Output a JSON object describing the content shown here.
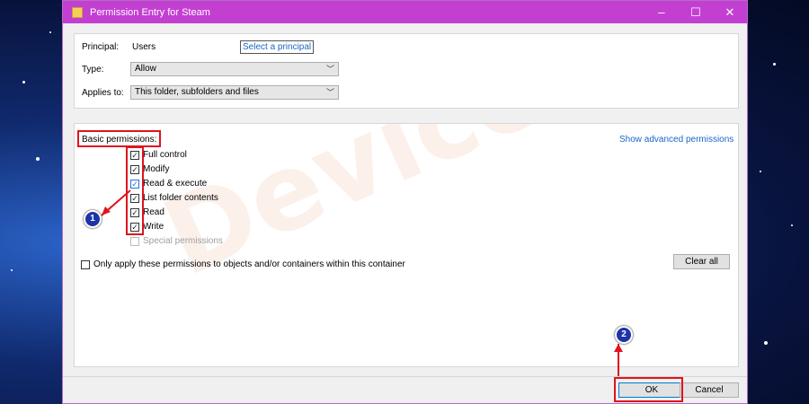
{
  "window": {
    "title": "Permission Entry for Steam"
  },
  "titlebar": {
    "minimize": "–",
    "maximize": "☐",
    "close": "✕"
  },
  "header": {
    "principal_label": "Principal:",
    "principal_value": "Users",
    "select_principal_link": "Select a principal",
    "type_label": "Type:",
    "type_value": "Allow",
    "applies_label": "Applies to:",
    "applies_value": "This folder, subfolders and files"
  },
  "permissions": {
    "heading": "Basic permissions:",
    "advanced_link": "Show advanced permissions",
    "items": [
      {
        "label": "Full control",
        "checked": true
      },
      {
        "label": "Modify",
        "checked": true
      },
      {
        "label": "Read & execute",
        "checked": true
      },
      {
        "label": "List folder contents",
        "checked": true
      },
      {
        "label": "Read",
        "checked": true
      },
      {
        "label": "Write",
        "checked": true
      },
      {
        "label": "Special permissions",
        "checked": false
      }
    ],
    "only_apply_label": "Only apply these permissions to objects and/or containers within this container",
    "clear_all": "Clear all"
  },
  "footer": {
    "ok": "OK",
    "cancel": "Cancel"
  },
  "annotations": {
    "badge1": "1",
    "badge2": "2",
    "accent": "#e0141b"
  },
  "watermark": "DeviceTricks"
}
